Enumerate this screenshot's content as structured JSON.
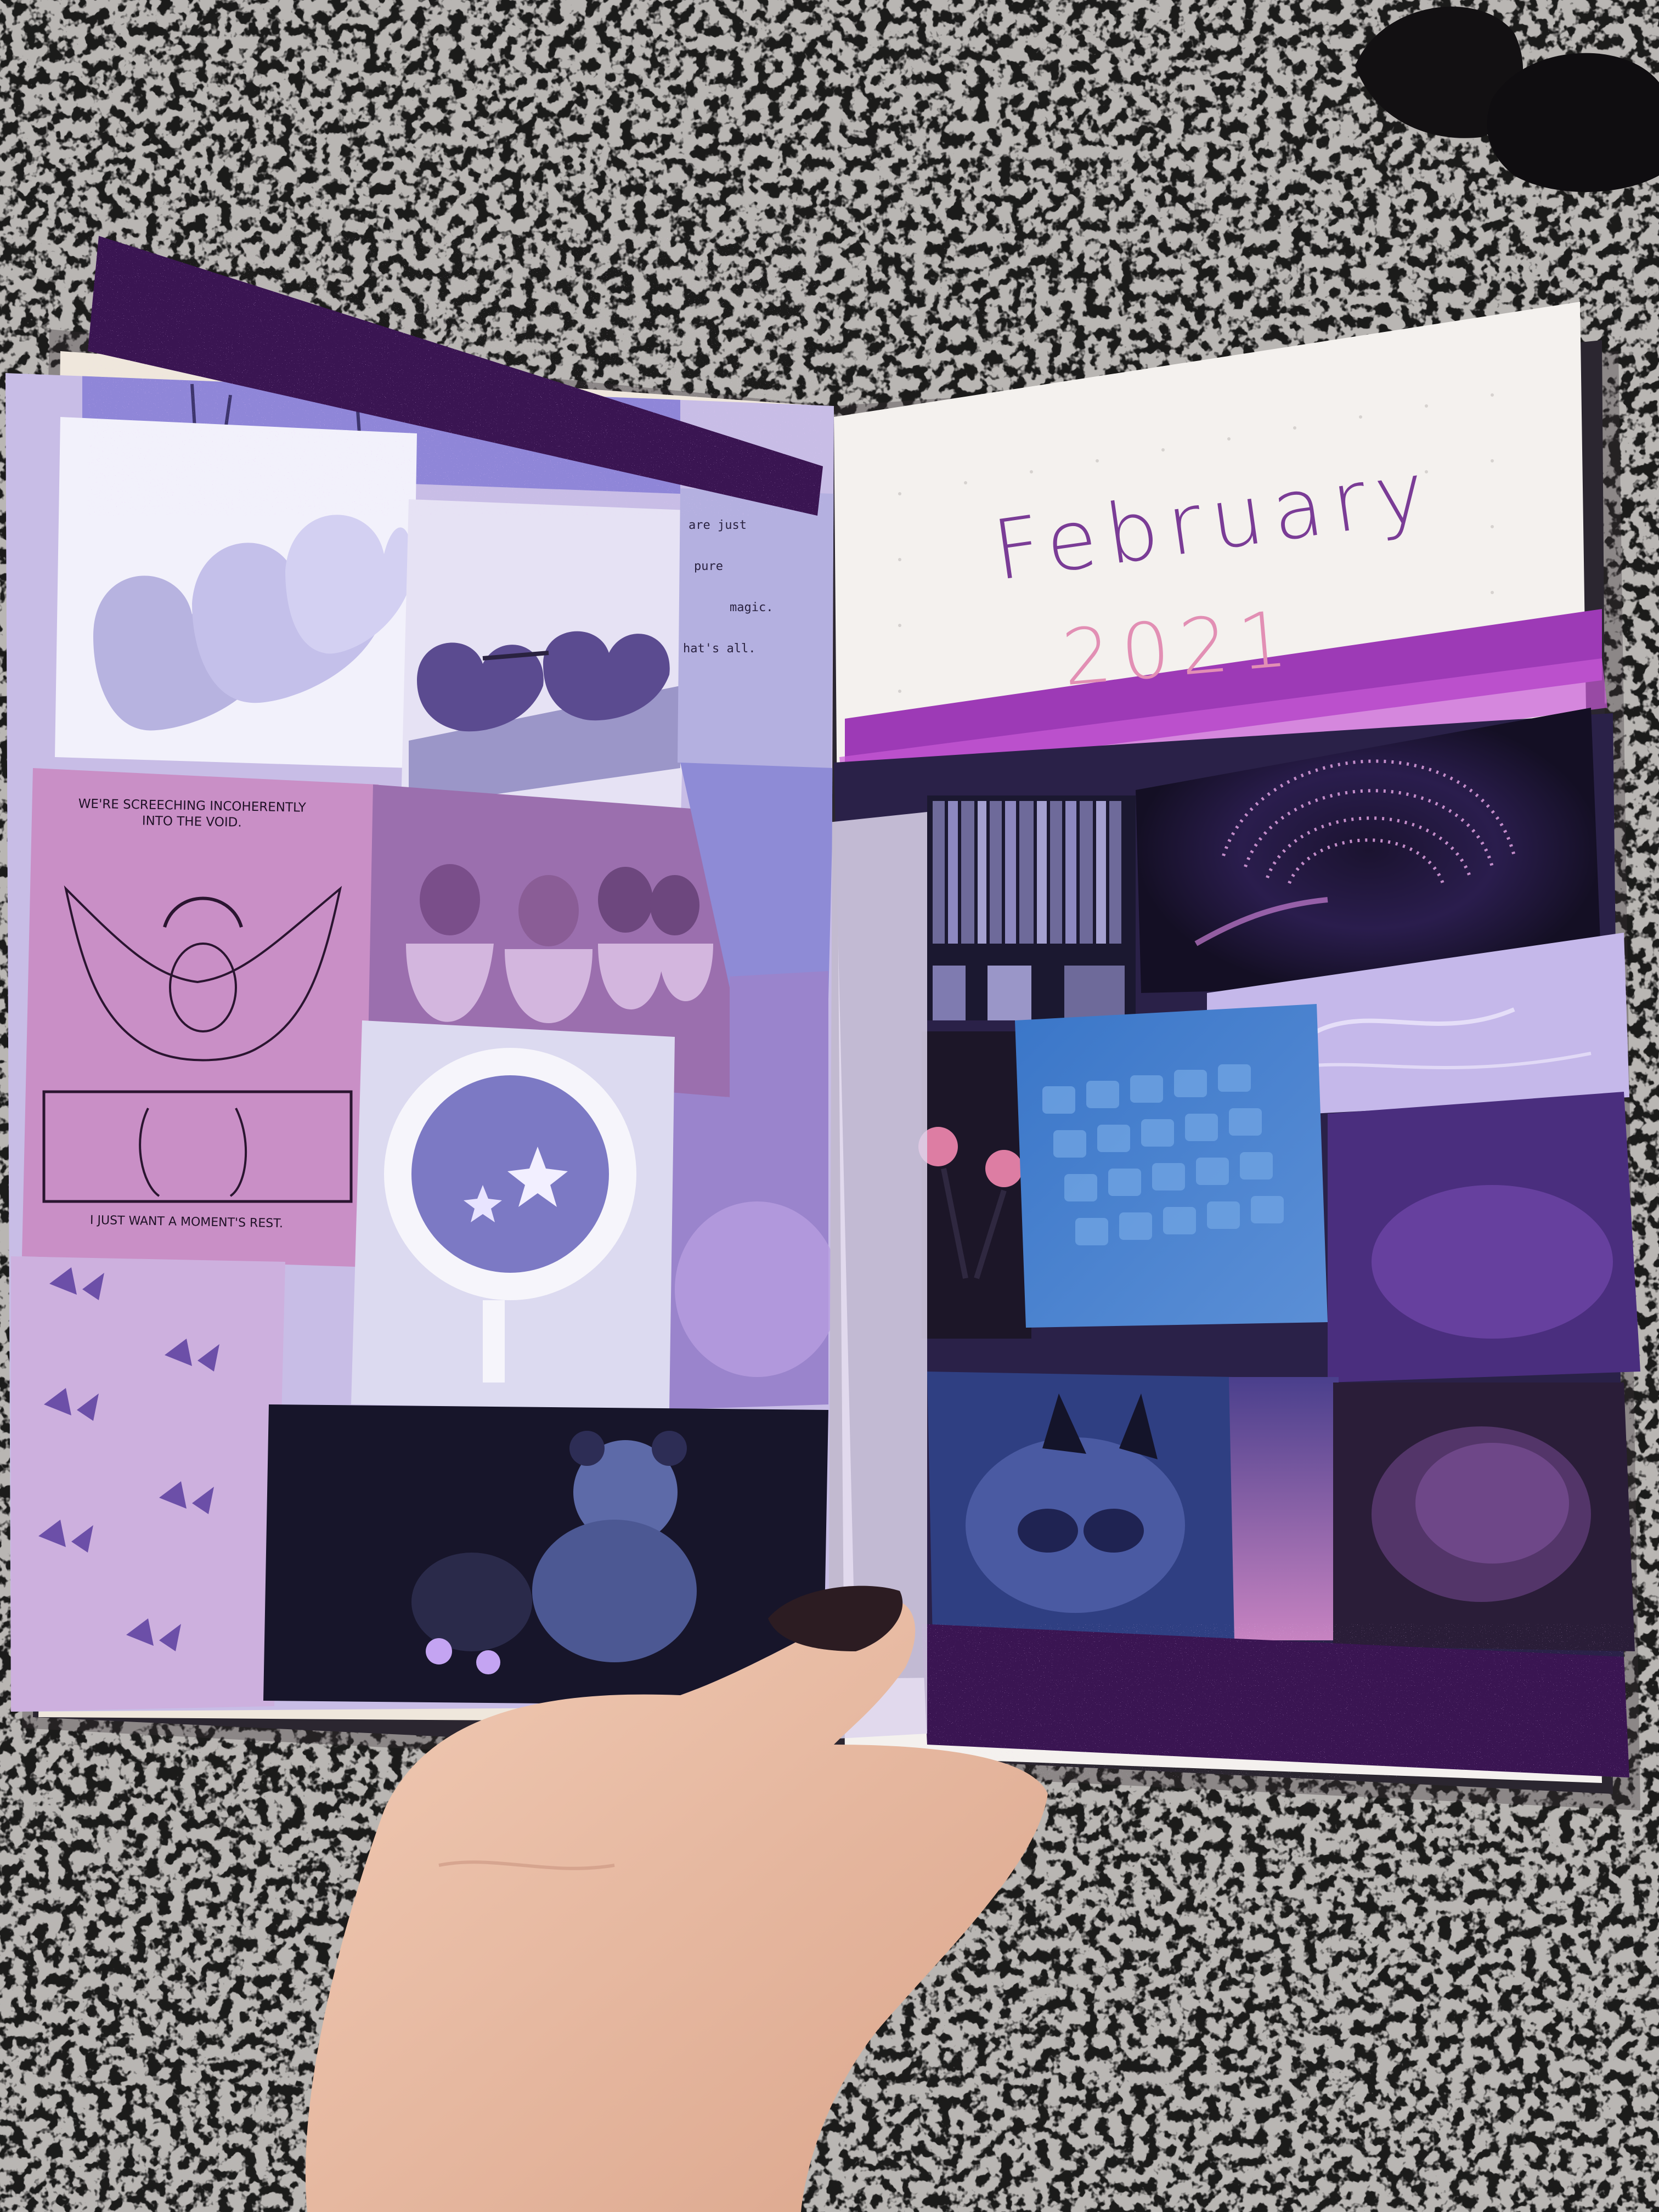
{
  "journal": {
    "title_month": "February",
    "title_year": "2021",
    "quote_lines": [
      "are just",
      "pure",
      "magic.",
      "hat's all."
    ],
    "comic_caption_top": "We're screeching incoherently into the void.",
    "comic_caption_bottom": "I just want a moment's rest."
  },
  "colors": {
    "glitter_tape": "#3a1552",
    "page_paper": "#f4f1ee",
    "title_purple": "#7a3c96",
    "title_pink": "#e28fb4",
    "comic_pink": "#c98fc6",
    "granite": "#b9b6b3"
  }
}
